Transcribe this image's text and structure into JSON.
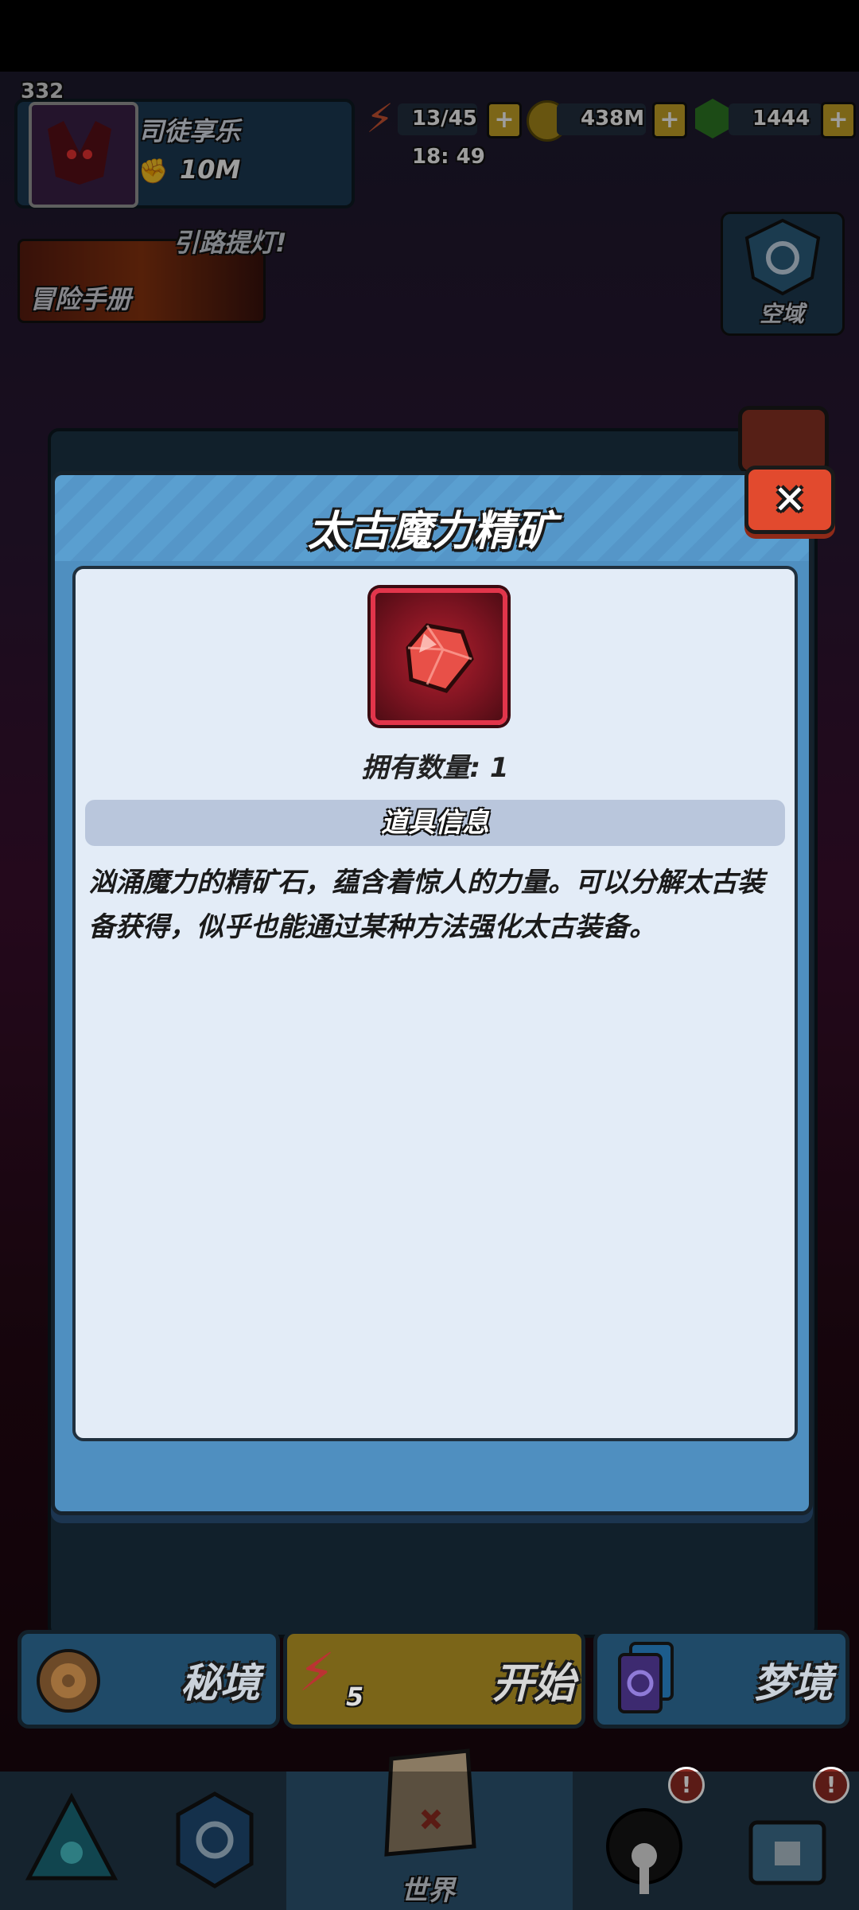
{
  "top_bar": {
    "level": "332",
    "player_name": "司徒享乐",
    "power": "10M",
    "stamina": "13/45",
    "timer": "18: 49",
    "gold": "438M",
    "gems": "1444",
    "plus": "+"
  },
  "banner": {
    "hint_text": "引路提灯!",
    "adventure_manual": "冒险手册",
    "sky_realm": "空域"
  },
  "dialog": {
    "title": "太古魔力精矿",
    "close_label": "✕",
    "owned_label": "拥有数量: 1",
    "info_header": "道具信息",
    "description": "汹涌魔力的精矿石，蕴含着惊人的力量。可以分解太古装备获得，似乎也能通过某种方法强化太古装备。"
  },
  "actions": {
    "secret_realm": "秘境",
    "start": "开始",
    "start_cost": "5",
    "dream_realm": "梦境"
  },
  "nav": {
    "world": "世界",
    "badge": "!"
  },
  "colors": {
    "dialog_blue": "#4f8fc0",
    "item_red": "#b3202e",
    "close_red": "#e24a2e",
    "start_yellow": "#e4b422"
  },
  "icons": [
    "avatar-icon",
    "fist-icon",
    "lightning-icon",
    "coin-icon",
    "gem-icon",
    "close-icon",
    "crystal-icon",
    "target-icon",
    "card-icon",
    "map-icon",
    "shield-icon",
    "pyramid-icon",
    "ghost-icon",
    "chest-icon"
  ]
}
